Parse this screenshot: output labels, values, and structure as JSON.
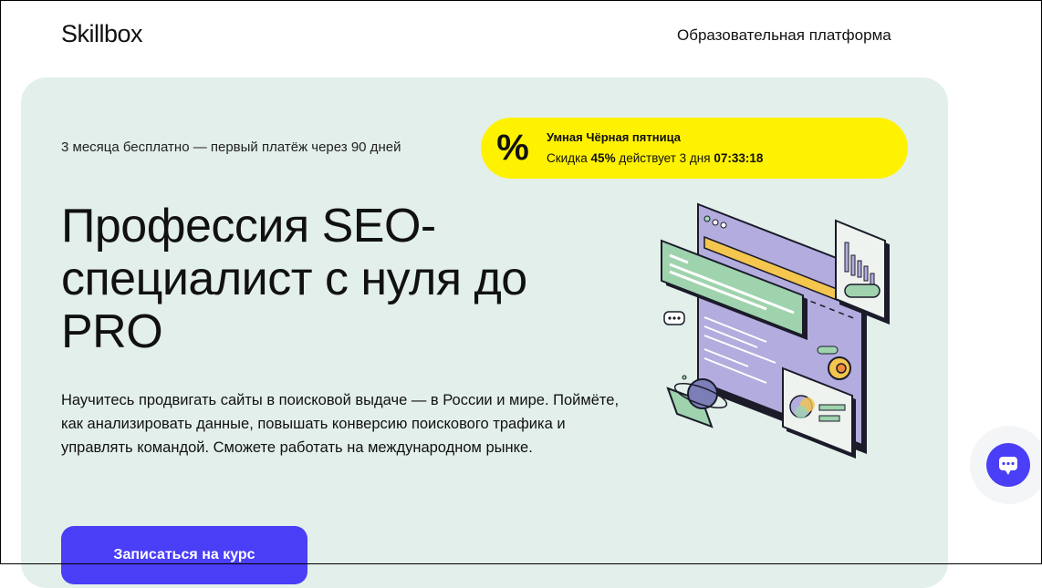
{
  "header": {
    "logo": "Skillbox",
    "platform_label": "Образовательная платформа"
  },
  "hero": {
    "free_note": "3 месяца бесплатно — первый платёж через 90 дней",
    "promo": {
      "icon": "percent-icon",
      "icon_glyph": "%",
      "title": "Умная Чёрная пятница",
      "sub_prefix": "Скидка ",
      "discount": "45%",
      "sub_middle": " действует 3 дня ",
      "timer": "07:33:18",
      "color": "#fff200"
    },
    "headline": "Профессия SEO-специалист с нуля до PRO",
    "description": "Научитесь продвигать сайты в поисковой выдаче — в России и мире. Поймёте, как анализировать данные, повышать конверсию поискового трафика и управлять командой. Сможете работать на международном рынке.",
    "cta_label": "Записаться на курс",
    "background_color": "#e3efea",
    "accent_color": "#4a3ef6"
  },
  "chat": {
    "icon": "chat-bubble-icon"
  }
}
